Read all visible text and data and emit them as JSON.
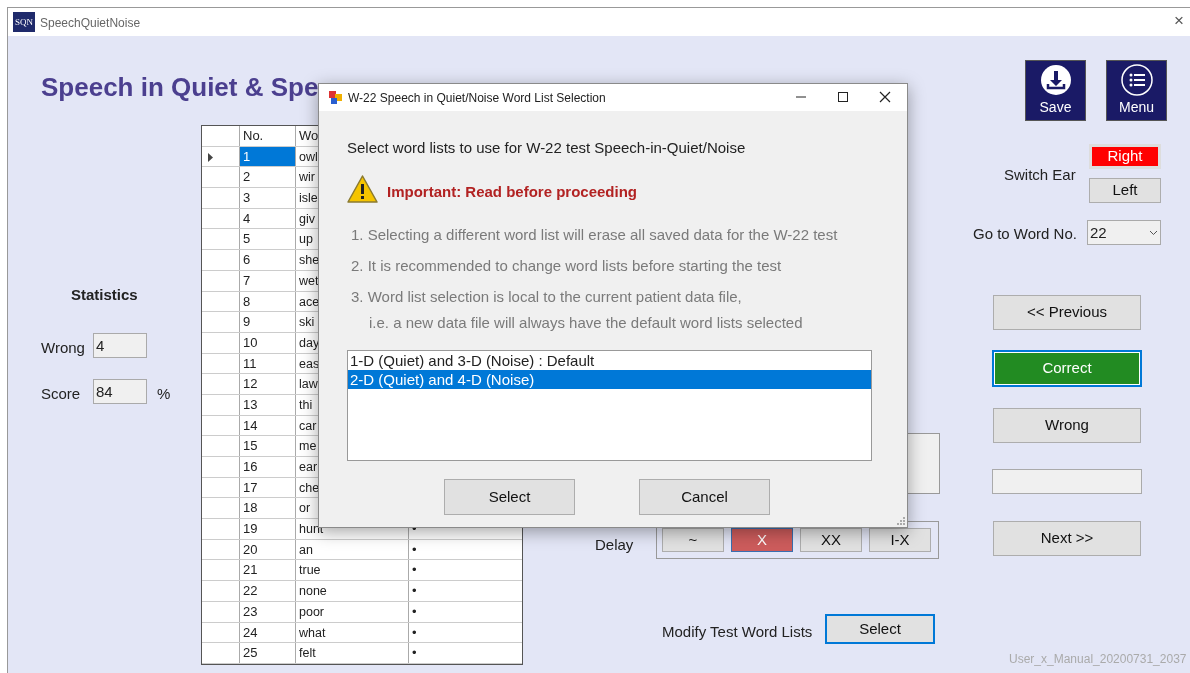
{
  "window": {
    "icon_text": "SQN",
    "title": "SpeechQuietNoise",
    "close": "×"
  },
  "heading": "Speech in Quiet & Spe",
  "statistics": {
    "title": "Statistics",
    "fields": [
      {
        "label": "Wrong",
        "value": "4"
      },
      {
        "label": "Score",
        "value": "84",
        "unit": "%"
      }
    ]
  },
  "table": {
    "columns": [
      "No.",
      "Wo"
    ],
    "rows": [
      {
        "no": "1",
        "word": "owl",
        "selected": true
      },
      {
        "no": "2",
        "word": "wir",
        "selected": false
      },
      {
        "no": "3",
        "word": "isle",
        "selected": false
      },
      {
        "no": "4",
        "word": "giv",
        "selected": false
      },
      {
        "no": "5",
        "word": "up",
        "selected": false
      },
      {
        "no": "6",
        "word": "she",
        "selected": false
      },
      {
        "no": "7",
        "word": "wet",
        "selected": false
      },
      {
        "no": "8",
        "word": "ace",
        "selected": false
      },
      {
        "no": "9",
        "word": "ski",
        "selected": false
      },
      {
        "no": "10",
        "word": "day",
        "selected": false
      },
      {
        "no": "11",
        "word": "eas",
        "selected": false
      },
      {
        "no": "12",
        "word": "law",
        "selected": false
      },
      {
        "no": "13",
        "word": "thi",
        "selected": false
      },
      {
        "no": "14",
        "word": "car",
        "selected": false
      },
      {
        "no": "15",
        "word": "me",
        "selected": false
      },
      {
        "no": "16",
        "word": "ear",
        "selected": false
      },
      {
        "no": "17",
        "word": "che",
        "selected": false
      },
      {
        "no": "18",
        "word": "or",
        "selected": false
      },
      {
        "no": "19",
        "word": "hunt",
        "mark": "•",
        "selected": false
      },
      {
        "no": "20",
        "word": "an",
        "mark": "•",
        "selected": false
      },
      {
        "no": "21",
        "word": "true",
        "mark": "•",
        "selected": false
      },
      {
        "no": "22",
        "word": "none",
        "mark": "•",
        "selected": false
      },
      {
        "no": "23",
        "word": "poor",
        "mark": "•",
        "selected": false
      },
      {
        "no": "24",
        "word": "what",
        "mark": "•",
        "selected": false
      },
      {
        "no": "25",
        "word": "felt",
        "mark": "•",
        "selected": false
      }
    ]
  },
  "toolbar": [
    {
      "kind": "save",
      "label": "Save"
    },
    {
      "kind": "menu",
      "label": "Menu"
    }
  ],
  "switch_ear": {
    "label": "Switch Ear",
    "options": [
      {
        "label": "Right",
        "selected": true
      },
      {
        "label": "Left",
        "selected": false
      }
    ]
  },
  "go_to_word": {
    "label": "Go to Word No.",
    "value": "22"
  },
  "answer_buttons": [
    {
      "kind": "button",
      "label": "<< Previous",
      "focused": false
    },
    {
      "kind": "success",
      "label": "Correct",
      "focused": true
    },
    {
      "kind": "button",
      "label": "Wrong",
      "focused": false
    },
    {
      "kind": "field"
    },
    {
      "kind": "button",
      "label": "Next >>",
      "focused": false
    }
  ],
  "delay": {
    "label": "Delay",
    "options": [
      {
        "label": "~",
        "selected": false
      },
      {
        "label": "X",
        "selected": true
      },
      {
        "label": "XX",
        "selected": false
      },
      {
        "label": "I-X",
        "selected": false
      }
    ]
  },
  "modify_lists": {
    "label": "Modify Test Word Lists",
    "button": "Select",
    "focused": true
  },
  "footer": "User_x_Manual_20200731_2037",
  "dialog": {
    "title": "W-22 Speech in Quiet/Noise Word List Selection",
    "prompt": "Select word lists to use for W-22 test Speech-in-Quiet/Noise",
    "warning": "Important: Read before proceeding",
    "notes": [
      "1. Selecting a different word list will erase all saved data for the W-22 test",
      "2. It is recommended to change word lists before starting the test",
      "3. Word list selection is local to the current patient data file,",
      "i.e. a new data file will always have the default word lists selected"
    ],
    "options": [
      {
        "label": "1-D (Quiet) and 3-D (Noise) : Default",
        "selected": false
      },
      {
        "label": "2-D (Quiet) and 4-D (Noise)",
        "selected": true
      }
    ],
    "buttons": [
      "Select",
      "Cancel"
    ]
  }
}
